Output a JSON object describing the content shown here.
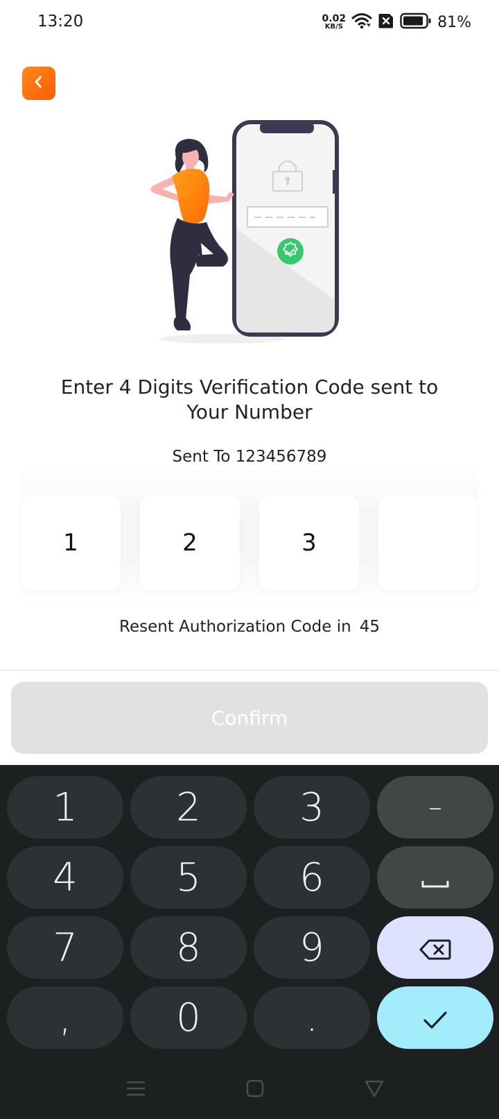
{
  "status_bar": {
    "time": "13:20",
    "net_speed_value": "0.02",
    "net_speed_unit": "KB/S",
    "battery_percent": "81%",
    "icons": [
      "wifi-icon",
      "sim-disabled-icon",
      "battery-icon"
    ]
  },
  "header": {
    "back_icon": "chevron-left-icon",
    "accent_color": "#ff6a00"
  },
  "main": {
    "headline": "Enter 4 Digits Verification Code sent to Your Number",
    "sent_to": "Sent To 123456789",
    "otp_digits": [
      "1",
      "2",
      "3",
      ""
    ],
    "resend_label": "Resent Authorization Code in",
    "resend_seconds": "45",
    "confirm_label": "Confirm"
  },
  "keyboard": {
    "digits": [
      "1",
      "2",
      "3",
      "4",
      "5",
      "6",
      "7",
      "8",
      "9",
      "0"
    ],
    "comma": ",",
    "dot": ".",
    "dash": "–",
    "space_icon": "space-icon",
    "delete_icon": "backspace-icon",
    "enter_icon": "checkmark-icon"
  },
  "nav_bar": {
    "icons": [
      "menu-icon",
      "home-icon",
      "back-triangle-icon"
    ]
  }
}
